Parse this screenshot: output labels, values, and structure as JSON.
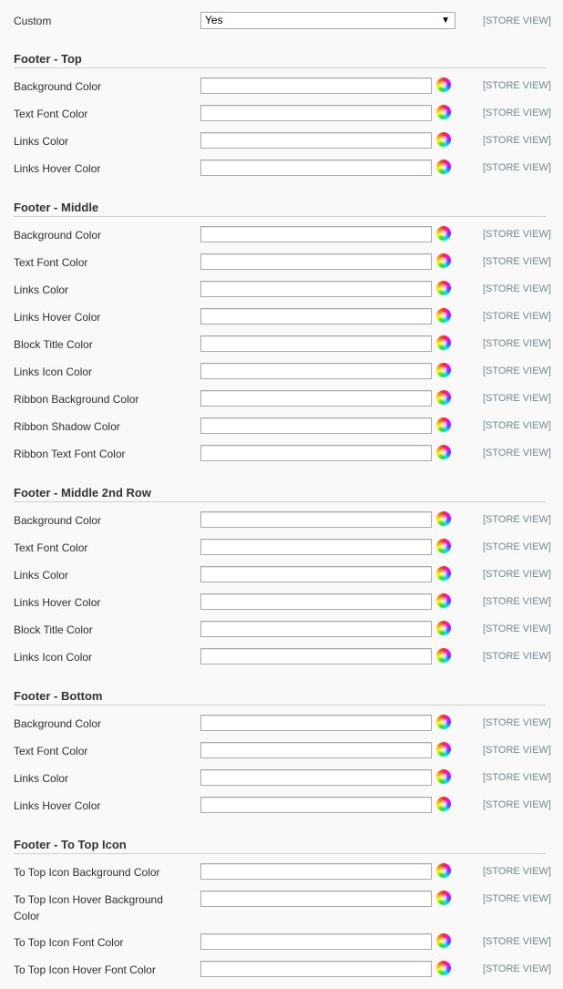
{
  "custom_row": {
    "label": "Custom",
    "value": "Yes",
    "scope": "[STORE VIEW]"
  },
  "sections": [
    {
      "title": "Footer - Top",
      "fields": [
        {
          "label": "Background Color"
        },
        {
          "label": "Text Font Color"
        },
        {
          "label": "Links Color"
        },
        {
          "label": "Links Hover Color"
        }
      ]
    },
    {
      "title": "Footer - Middle",
      "fields": [
        {
          "label": "Background Color"
        },
        {
          "label": "Text Font Color"
        },
        {
          "label": "Links Color"
        },
        {
          "label": "Links Hover Color"
        },
        {
          "label": "Block Title Color"
        },
        {
          "label": "Links Icon Color"
        },
        {
          "label": "Ribbon Background Color"
        },
        {
          "label": "Ribbon Shadow Color"
        },
        {
          "label": "Ribbon Text Font Color"
        }
      ]
    },
    {
      "title": "Footer - Middle 2nd Row",
      "fields": [
        {
          "label": "Background Color"
        },
        {
          "label": "Text Font Color"
        },
        {
          "label": "Links Color"
        },
        {
          "label": "Links Hover Color"
        },
        {
          "label": "Block Title Color"
        },
        {
          "label": "Links Icon Color"
        }
      ]
    },
    {
      "title": "Footer - Bottom",
      "fields": [
        {
          "label": "Background Color"
        },
        {
          "label": "Text Font Color"
        },
        {
          "label": "Links Color"
        },
        {
          "label": "Links Hover Color"
        }
      ]
    },
    {
      "title": "Footer - To Top Icon",
      "fields": [
        {
          "label": "To Top Icon Background Color"
        },
        {
          "label": "To Top Icon Hover Background Color"
        },
        {
          "label": "To Top Icon Font Color"
        },
        {
          "label": "To Top Icon Hover Font Color"
        }
      ]
    }
  ],
  "scope_label": "[STORE VIEW]",
  "picker_icon": "color-wheel-icon"
}
